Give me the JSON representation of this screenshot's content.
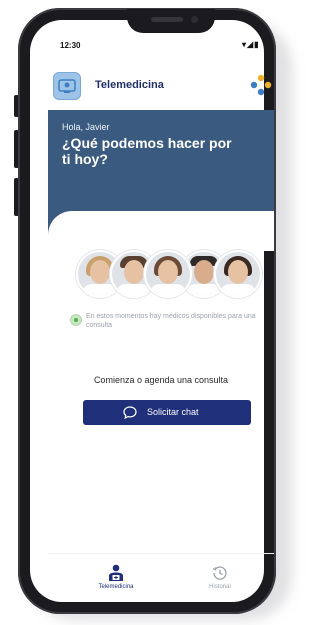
{
  "status_bar": {
    "time": "12:30",
    "icons": "▾◢▮"
  },
  "header": {
    "app_title": "Telemedicina"
  },
  "hero": {
    "greeting": "Hola, Javier",
    "title": "¿Qué podemos hacer por ti hoy?"
  },
  "availability": {
    "text": "En estos momentos hay médicos disponibles para una consulta"
  },
  "cta": {
    "label": "Comienza o agenda una consulta",
    "button_label": "Solicitar chat"
  },
  "tabs": [
    {
      "label": "Telemedicina",
      "icon": "doctor-icon",
      "active": true
    },
    {
      "label": "Historial",
      "icon": "history-icon",
      "active": false
    }
  ],
  "colors": {
    "primary": "#1f2f7a",
    "hero": "#3a5a7f",
    "available": "#4caf50",
    "inactive": "#9ba2ab"
  }
}
